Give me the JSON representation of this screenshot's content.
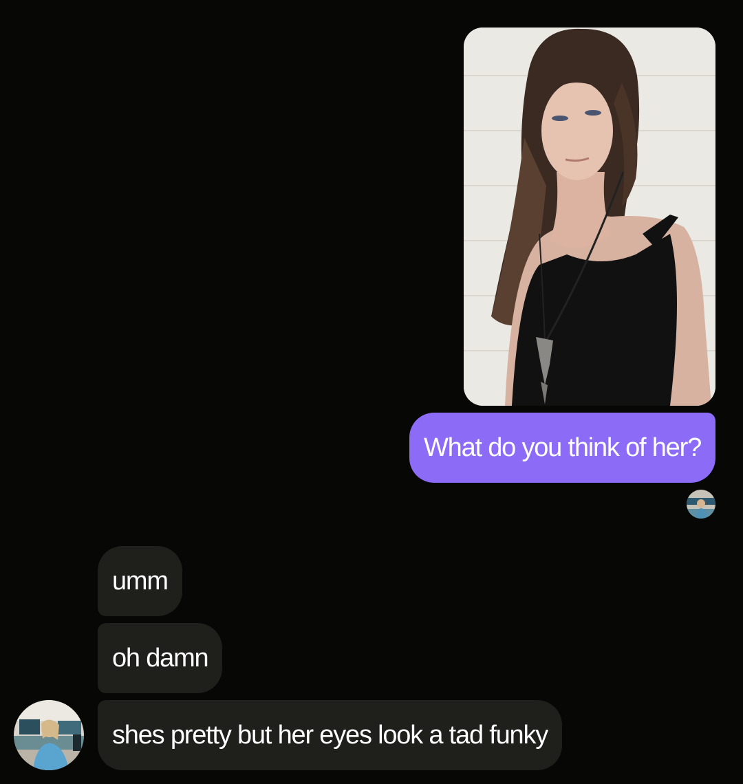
{
  "conversation": {
    "outgoing": {
      "photo": {
        "description_icon": "photo-of-woman-in-black-top"
      },
      "text": "What do you think of her?",
      "bubble_color": "#8c6cf7"
    },
    "read_receipt": {
      "icon": "avatar-thumbnail"
    },
    "incoming": {
      "bubble_color": "#1f1f1c",
      "messages": [
        "umm",
        "oh damn",
        "shes pretty but her eyes look a tad funky"
      ],
      "avatar_icon": "sender-avatar-photo"
    }
  },
  "colors": {
    "background": "#070805",
    "text": "#ffffff"
  }
}
